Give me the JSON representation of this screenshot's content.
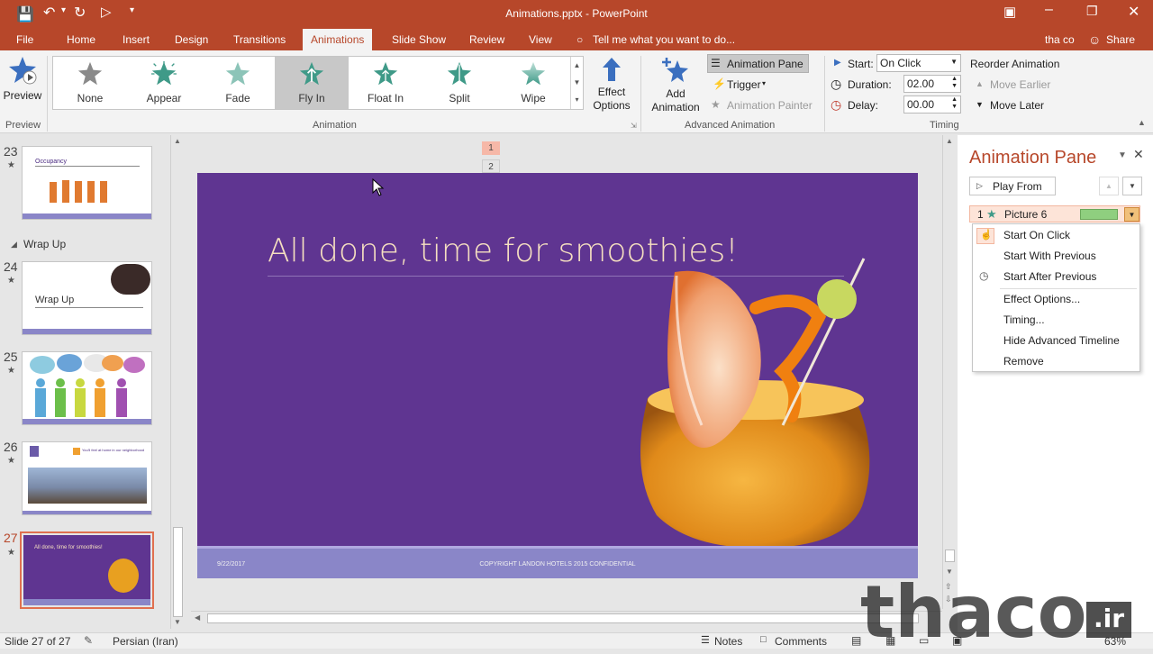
{
  "titlebar": {
    "doc_title": "Animations.pptx - PowerPoint"
  },
  "tabs": {
    "file": "File",
    "home": "Home",
    "insert": "Insert",
    "design": "Design",
    "transitions": "Transitions",
    "animations": "Animations",
    "slideshow": "Slide Show",
    "review": "Review",
    "view": "View",
    "tellme": "Tell me what you want to do...",
    "user": "tha co",
    "share": "Share"
  },
  "ribbon": {
    "preview_label": "Preview",
    "preview_group": "Preview",
    "effects": [
      "None",
      "Appear",
      "Fade",
      "Fly In",
      "Float In",
      "Split",
      "Wipe"
    ],
    "animation_group": "Animation",
    "effect_options_line1": "Effect",
    "effect_options_line2": "Options",
    "add_anim_line1": "Add",
    "add_anim_line2": "Animation",
    "animation_pane": "Animation Pane",
    "trigger": "Trigger",
    "animation_painter": "Animation Painter",
    "advanced_group": "Advanced Animation",
    "start_label": "Start:",
    "start_value": "On Click",
    "duration_label": "Duration:",
    "duration_value": "02.00",
    "delay_label": "Delay:",
    "delay_value": "00.00",
    "reorder_title": "Reorder Animation",
    "move_earlier": "Move Earlier",
    "move_later": "Move Later",
    "timing_group": "Timing"
  },
  "thumbnails": {
    "section_name": "Wrap Up",
    "slides": [
      {
        "num": "23",
        "text": "Occupancy"
      },
      {
        "num": "24",
        "text": "Wrap Up"
      },
      {
        "num": "25",
        "text": ""
      },
      {
        "num": "26",
        "text": "You'll feel at home in our neighborhood"
      },
      {
        "num": "27",
        "text": "All done, time for smoothies!"
      }
    ],
    "occupancy_values": [
      78,
      82,
      80,
      81,
      79
    ]
  },
  "slide": {
    "title": "All done, time for smoothies!",
    "date": "9/22/2017",
    "footer": "COPYRIGHT LANDON HOTELS 2015 CONFIDENTIAL",
    "anim_tag1": "1",
    "anim_tag2": "2"
  },
  "pane": {
    "title": "Animation Pane",
    "play_from": "Play From",
    "item_num": "1",
    "item_name": "Picture 6",
    "menu": [
      "Start On Click",
      "Start With Previous",
      "Start After Previous",
      "Effect Options...",
      "Timing...",
      "Hide Advanced Timeline",
      "Remove"
    ]
  },
  "status": {
    "slide_info": "Slide 27 of 27",
    "language": "Persian (Iran)",
    "notes": "Notes",
    "comments": "Comments",
    "zoom": "63%"
  },
  "watermark": "thaco",
  "watermark_ir": ".ir",
  "colors": {
    "accent": "#b7472a",
    "slide_bg": "#5f3591",
    "footer_bg": "#8a86c8",
    "title_text": "#f5dfc0"
  }
}
